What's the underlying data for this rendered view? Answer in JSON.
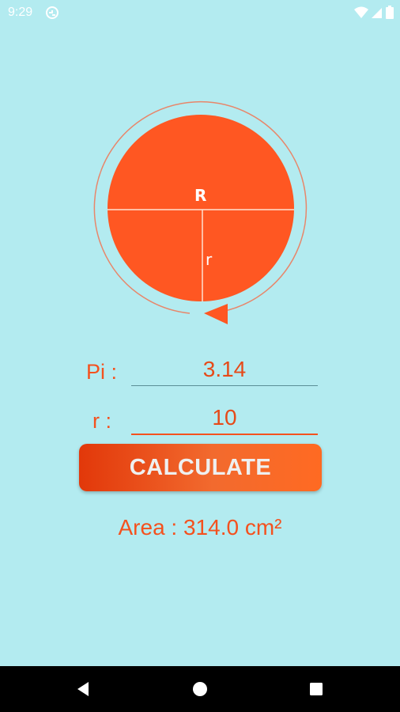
{
  "status_bar": {
    "time": "9:29",
    "icons": [
      "sync-icon",
      "wifi-icon",
      "signal-icon",
      "battery-icon"
    ]
  },
  "diagram": {
    "label_diameter": "R",
    "label_radius": "r",
    "colors": {
      "circle_fill": "#ff5722",
      "ring": "#e8866a",
      "arrow": "#ff5722",
      "lines": "#ffe0d0"
    }
  },
  "form": {
    "pi": {
      "label": "Pi :",
      "value": "3.14"
    },
    "radius": {
      "label": "r :",
      "value": "10"
    }
  },
  "calculate_button": {
    "label": "CALCULATE"
  },
  "result": {
    "text": "Area : 314.0 cm²"
  },
  "navigation": {
    "icons": [
      "back-icon",
      "home-icon",
      "recents-icon"
    ]
  },
  "colors": {
    "background": "#b3ebf0",
    "accent": "#f4511e",
    "button_start": "#e2380a",
    "button_end": "#ff6a22"
  }
}
